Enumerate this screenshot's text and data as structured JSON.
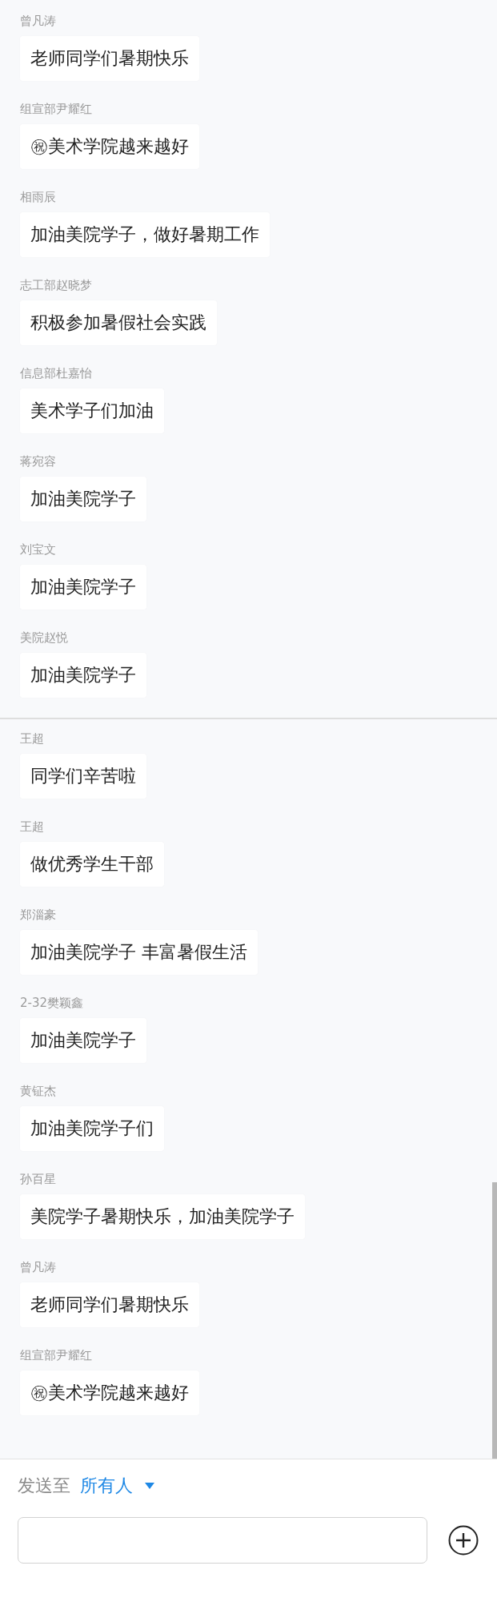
{
  "message_groups": [
    {
      "messages": [
        {
          "sender": "曾凡涛",
          "text": "老师同学们暑期快乐"
        },
        {
          "sender": "组宣部尹耀红",
          "text": "㊗美术学院越来越好"
        },
        {
          "sender": "相雨辰",
          "text": "加油美院学子，做好暑期工作"
        },
        {
          "sender": "志工部赵晓梦",
          "text": "积极参加暑假社会实践"
        },
        {
          "sender": "信息部杜嘉怡",
          "text": "美术学子们加油"
        },
        {
          "sender": "蒋宛容",
          "text": "加油美院学子"
        },
        {
          "sender": "刘宝文",
          "text": "加油美院学子"
        },
        {
          "sender": "美院赵悦",
          "text": "加油美院学子"
        }
      ]
    },
    {
      "messages": [
        {
          "sender": "王超",
          "text": "同学们辛苦啦"
        },
        {
          "sender": "王超",
          "text": "做优秀学生干部"
        },
        {
          "sender": "郑淄豪",
          "text": "加油美院学子 丰富暑假生活"
        },
        {
          "sender": "2-32樊颖鑫",
          "text": "加油美院学子"
        },
        {
          "sender": "黄钲杰",
          "text": "加油美院学子们"
        },
        {
          "sender": "孙百星",
          "text": "美院学子暑期快乐，加油美院学子"
        },
        {
          "sender": "曾凡涛",
          "text": "老师同学们暑期快乐"
        },
        {
          "sender": "组宣部尹耀红",
          "text": "㊗美术学院越来越好"
        }
      ]
    }
  ],
  "composer": {
    "send_to_label": "发送至",
    "recipient": "所有人"
  }
}
